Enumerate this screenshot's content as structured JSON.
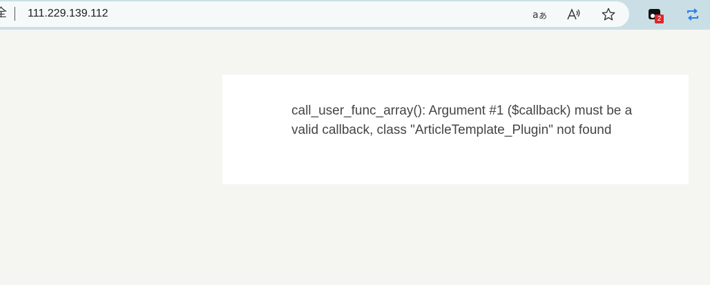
{
  "browser": {
    "site_info_glyph": "全",
    "url": "111.229.139.112",
    "actions": {
      "translate_icon": "translate-icon",
      "read_aloud_icon": "read-aloud-icon",
      "favorite_icon": "star-icon"
    },
    "extension": {
      "icon": "extension-icon",
      "badge_count": "2"
    },
    "accent_color": "#2b7de9"
  },
  "page": {
    "error_message": "call_user_func_array(): Argument #1 ($callback) must be a valid callback, class \"ArticleTemplate_Plugin\" not found"
  }
}
